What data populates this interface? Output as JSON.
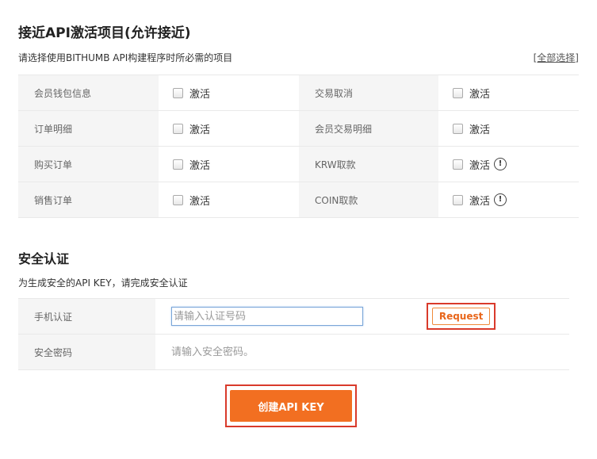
{
  "api_section": {
    "title": "接近API激活项目(允许接近)",
    "subtitle": "请选择使用BITHUMB API构建程序时所必需的项目",
    "select_all": "[全部选择]",
    "rows": [
      [
        {
          "label": "会员钱包信息",
          "action": "激活",
          "warning": false
        },
        {
          "label": "交易取消",
          "action": "激活",
          "warning": false
        }
      ],
      [
        {
          "label": "订单明细",
          "action": "激活",
          "warning": false
        },
        {
          "label": "会员交易明细",
          "action": "激活",
          "warning": false
        }
      ],
      [
        {
          "label": "购买订单",
          "action": "激活",
          "warning": false
        },
        {
          "label": "KRW取款",
          "action": "激活",
          "warning": true
        }
      ],
      [
        {
          "label": "销售订单",
          "action": "激活",
          "warning": false
        },
        {
          "label": "COIN取款",
          "action": "激活",
          "warning": true
        }
      ]
    ],
    "warning_glyph": "!"
  },
  "security_section": {
    "title": "安全认证",
    "subtitle": "为生成安全的API KEY，请完成安全认证",
    "phone_label": "手机认证",
    "phone_placeholder": "请输入认证号码",
    "request_label": "Request",
    "password_label": "安全密码",
    "password_placeholder": "请输入安全密码。"
  },
  "create_button": "创建API KEY",
  "colors": {
    "accent": "#f26f21",
    "highlight_border": "#d93a2b"
  }
}
